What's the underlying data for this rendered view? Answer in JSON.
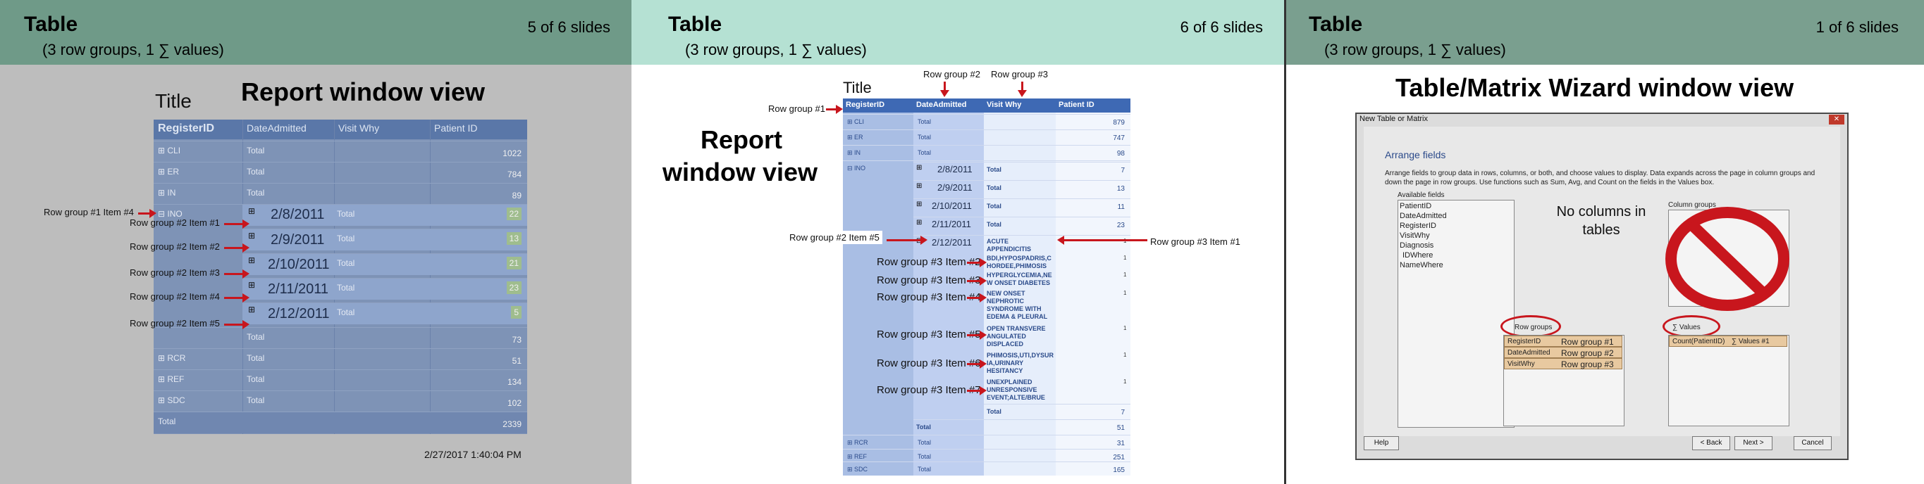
{
  "slides": [
    {
      "title": "Table",
      "subtitle": "(3 row groups, 1 ∑ values)",
      "slide_count": "5 of 6 slides",
      "report_title": "Title",
      "heading": "Report window view",
      "columns": [
        "RegisterID",
        "DateAdmitted",
        "Visit Why",
        "Patient ID"
      ],
      "rows": [
        {
          "group": "CLI",
          "label": "Total",
          "value": "1022"
        },
        {
          "group": "ER",
          "label": "Total",
          "value": "784"
        },
        {
          "group": "IN",
          "label": "Total",
          "value": "89"
        },
        {
          "group": "INO",
          "label": "",
          "value": ""
        },
        {
          "group": "",
          "label": "Total",
          "value": "73"
        },
        {
          "group": "RCR",
          "label": "Total",
          "value": "51"
        },
        {
          "group": "REF",
          "label": "Total",
          "value": "134"
        },
        {
          "group": "SDC",
          "label": "Total",
          "value": "102"
        },
        {
          "group": "Total",
          "label": "",
          "value": "2339"
        }
      ],
      "dates": [
        {
          "date": "2/8/2011",
          "label": "Total",
          "value": "22"
        },
        {
          "date": "2/9/2011",
          "label": "Total",
          "value": "13"
        },
        {
          "date": "2/10/2011",
          "label": "Total",
          "value": "21"
        },
        {
          "date": "2/11/2011",
          "label": "Total",
          "value": "23"
        },
        {
          "date": "2/12/2011",
          "label": "Total",
          "value": "5"
        }
      ],
      "annotations": [
        "Row group #1 Item #4",
        "Row group #2 Item #1",
        "Row group #2 Item #2",
        "Row group #2 Item #3",
        "Row group #2 Item #4",
        "Row group #2 Item #5"
      ],
      "timestamp": "2/27/2017   1:40:04 PM"
    },
    {
      "title": "Table",
      "subtitle": "(3 row groups, 1 ∑ values)",
      "slide_count": "6 of 6 slides",
      "report_title": "Title",
      "heading_line1": "Report",
      "heading_line2": "window view",
      "columns": [
        "RegisterID",
        "DateAdmitted",
        "Visit Why",
        "Patient ID"
      ],
      "top_labels": [
        "Row group #2",
        "Row group #3"
      ],
      "row_group_1_label": "Row group #1",
      "rows_top": [
        {
          "group": "CLI",
          "label": "Total",
          "value": "879"
        },
        {
          "group": "ER",
          "label": "Total",
          "value": "747"
        },
        {
          "group": "IN",
          "label": "Total",
          "value": "98"
        },
        {
          "group": "INO",
          "label": "",
          "value": ""
        }
      ],
      "dates": [
        {
          "date": "2/8/2011",
          "label": "Total",
          "value": "7"
        },
        {
          "date": "2/9/2011",
          "label": "Total",
          "value": "13"
        },
        {
          "date": "2/10/2011",
          "label": "Total",
          "value": "11"
        },
        {
          "date": "2/11/2011",
          "label": "Total",
          "value": "23"
        },
        {
          "date": "2/12/2011",
          "label": "",
          "value": ""
        }
      ],
      "visit_why": [
        "ACUTE APPENDICITIS",
        "BDI,HYPOSPADRIS,C HORDEE,PHIMOSIS",
        "HYPERGLYCEMIA,NE W ONSET DIABETES",
        "NEW ONSET NEPHROTIC SYNDROME WITH EDEMA & PLEURAL",
        "OPEN TRANSVERE ANGULATED DISPLACED",
        "PHIMOSIS,UTI,DYSUR IA,URINARY HESITANCY",
        "UNEXPLAINED UNRESPONSIVE EVENT;ALTE/BRUE"
      ],
      "visit_values": [
        "1",
        "1",
        "1",
        "1",
        "1",
        "1",
        "1"
      ],
      "left_annotations": [
        "Row group #2 Item #5",
        "Row group #3 Item #2",
        "Row group #3 Item #3",
        "Row group #3 Item #4",
        "Row group #3 Item #5",
        "Row group #3 Item #6",
        "Row group #3 Item #7"
      ],
      "right_annotation": "Row group #3 Item #1",
      "totals": [
        {
          "label": "Total",
          "value": "7"
        },
        {
          "label": "Total",
          "value": "51"
        }
      ],
      "rows_bottom": [
        {
          "group": "RCR",
          "label": "Total",
          "value": "31"
        },
        {
          "group": "REF",
          "label": "Total",
          "value": "251"
        },
        {
          "group": "SDC",
          "label": "Total",
          "value": "165"
        }
      ]
    },
    {
      "title": "Table",
      "subtitle": "(3 row groups, 1 ∑ values)",
      "slide_count": "1 of 6 slides",
      "heading": "Table/Matrix Wizard window view",
      "dialog_title": "New Table or Matrix",
      "arrange_heading": "Arrange fields",
      "arrange_desc": "Arrange fields to group data in rows, columns, or both, and choose values to display. Data expands across the page in column groups and down the page in row groups.  Use functions such as Sum, Avg, and Count on the fields in the Values box.",
      "available_label": "Available fields",
      "available_fields": [
        "PatientID",
        "DateAdmitted",
        "RegisterID",
        "VisitWhy",
        "Diagnosis",
        "IDWhere",
        "NameWhere"
      ],
      "no_columns_line1": "No columns in",
      "no_columns_line2": "tables",
      "column_groups_label": "Column groups",
      "row_groups_label": "Row groups",
      "values_label": "∑  Values",
      "row_group_items": [
        {
          "field": "RegisterID",
          "label": "Row group #1"
        },
        {
          "field": "DateAdmitted",
          "label": "Row group #2"
        },
        {
          "field": "VisitWhy",
          "label": "Row group #3"
        }
      ],
      "value_item": {
        "field": "Count(PatientID)",
        "label": "∑ Values #1"
      },
      "buttons": {
        "help": "Help",
        "back": "< Back",
        "next": "Next >",
        "cancel": "Cancel"
      }
    }
  ]
}
